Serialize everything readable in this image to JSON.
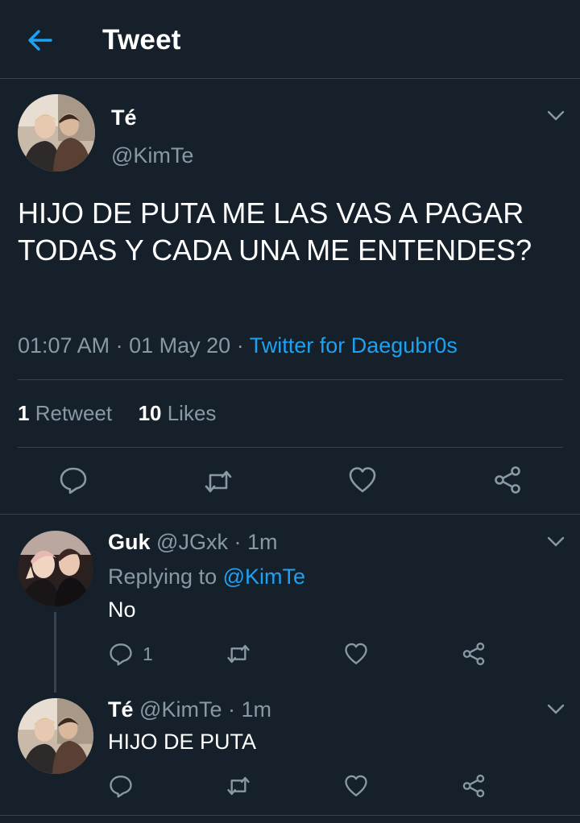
{
  "header": {
    "title": "Tweet"
  },
  "main_tweet": {
    "display_name": "Té",
    "handle": "@KimTe",
    "text": "HIJO DE PUTA ME LAS VAS A PAGAR TODAS Y CADA UNA ME ENTENDES?",
    "time": "01:07 AM",
    "date": "01 May 20",
    "separator": "·",
    "source": "Twitter for Daegubr0s",
    "retweet_count": "1",
    "retweet_label": "Retweet",
    "like_count": "10",
    "like_label": "Likes"
  },
  "replies": [
    {
      "display_name": "Guk",
      "handle": "@JGxk",
      "separator": "·",
      "time": "1m",
      "replying_prefix": "Replying to",
      "replying_handle": "@KimTe",
      "text": "No",
      "reply_count": "1"
    },
    {
      "display_name": "Té",
      "handle": "@KimTe",
      "separator": "·",
      "time": "1m",
      "text": "HIJO DE PUTA"
    }
  ],
  "icons": {
    "back": "arrow-left-icon",
    "more": "chevron-down-icon",
    "reply": "reply-icon",
    "retweet": "retweet-icon",
    "like": "heart-icon",
    "share": "share-icon"
  },
  "colors": {
    "background": "#15202b",
    "accent": "#1da1f2",
    "muted": "#8899a6",
    "divider": "#38444d"
  }
}
